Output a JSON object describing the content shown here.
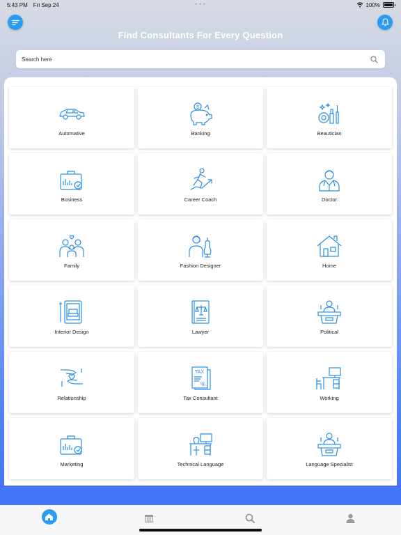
{
  "status_bar": {
    "time": "5:43 PM",
    "date": "Fri Sep 24",
    "battery": "100%",
    "battery_level": 1.0,
    "dots": "• • •"
  },
  "header": {
    "title": "Find Consultants For Every Question"
  },
  "search": {
    "placeholder": "Search here"
  },
  "categories": [
    {
      "label": "Automative",
      "icon": "car-icon"
    },
    {
      "label": "Banking",
      "icon": "piggy-bank-icon"
    },
    {
      "label": "Beautician",
      "icon": "cosmetics-icon"
    },
    {
      "label": "Business",
      "icon": "briefcase-icon"
    },
    {
      "label": "Career Coach",
      "icon": "runner-growth-icon"
    },
    {
      "label": "Doctor",
      "icon": "doctor-icon"
    },
    {
      "label": "Family",
      "icon": "family-icon"
    },
    {
      "label": "Fashion Designer",
      "icon": "fashion-designer-icon"
    },
    {
      "label": "Home",
      "icon": "house-icon"
    },
    {
      "label": "Interior Design",
      "icon": "interior-tablet-icon"
    },
    {
      "label": "Lawyer",
      "icon": "law-book-icon"
    },
    {
      "label": "Political",
      "icon": "podium-icon"
    },
    {
      "label": "Relationship",
      "icon": "hands-heart-icon"
    },
    {
      "label": "Tax Consultant",
      "icon": "tax-document-icon"
    },
    {
      "label": "Working",
      "icon": "workstation-icon"
    },
    {
      "label": "Marketing",
      "icon": "marketing-briefcase-icon"
    },
    {
      "label": "Technical Language",
      "icon": "technical-desk-icon"
    },
    {
      "label": "Language Specialist",
      "icon": "speaker-podium-icon"
    }
  ],
  "tabbar": [
    {
      "name": "home",
      "icon": "home-icon",
      "active": true
    },
    {
      "name": "calendar",
      "icon": "calendar-icon",
      "active": false
    },
    {
      "name": "search",
      "icon": "search-icon",
      "active": false
    },
    {
      "name": "profile",
      "icon": "user-icon",
      "active": false
    }
  ],
  "colors": {
    "accent": "#2d9bf0",
    "icon_stroke": "#2a8fe6",
    "text": "#222222"
  }
}
